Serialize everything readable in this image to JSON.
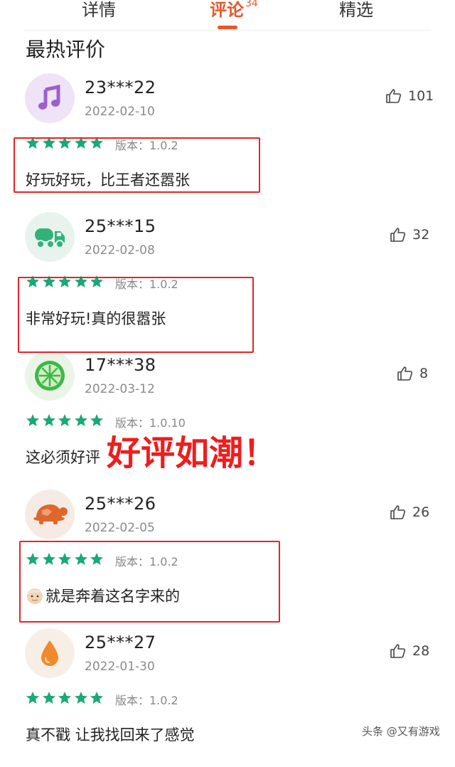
{
  "tabs": [
    {
      "label": "详情"
    },
    {
      "label": "评论",
      "count": "34"
    },
    {
      "label": "精选"
    }
  ],
  "section_title": "最热评价",
  "reviews": [
    {
      "user": "23***22",
      "date": "2022-02-10",
      "likes": "101",
      "stars": 5,
      "version": "版本：1.0.2",
      "text": "好玩好玩，比王者还嚣张",
      "avatar_icon": "music-note-icon",
      "avatar_color": "#9c5fd0"
    },
    {
      "user": "25***15",
      "date": "2022-02-08",
      "likes": "32",
      "stars": 5,
      "version": "版本：1.0.2",
      "text": "非常好玩!真的很嚣张",
      "avatar_icon": "truck-icon",
      "avatar_color": "#2fb37a"
    },
    {
      "user": "17***38",
      "date": "2022-03-12",
      "likes": "8",
      "stars": 5,
      "version": "版本：1.0.10",
      "text": "这必须好评",
      "avatar_icon": "lime-icon",
      "avatar_color": "#3db848"
    },
    {
      "user": "25***26",
      "date": "2022-02-05",
      "likes": "26",
      "stars": 5,
      "version": "版本：1.0.2",
      "text": "就是奔着这名字来的",
      "avatar_icon": "turtle-icon",
      "avatar_color": "#e0672a"
    },
    {
      "user": "25***27",
      "date": "2022-01-30",
      "likes": "28",
      "stars": 5,
      "version": "版本：1.0.2",
      "text": "真不戳 让我找回来了感觉",
      "avatar_icon": "drop-icon",
      "avatar_color": "#f08a2c"
    }
  ],
  "overlay_text": "好评如潮！",
  "watermark": "头条 @又有游戏",
  "colors": {
    "accent": "#e8572a",
    "star": "#19a974",
    "highlight_box": "#e0262a"
  }
}
